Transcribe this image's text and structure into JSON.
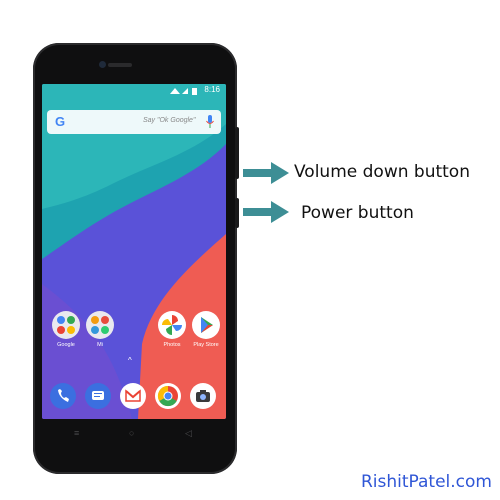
{
  "status_bar": {
    "time": "8:16"
  },
  "search": {
    "logo": "G",
    "placeholder": "Say \"Ok Google\""
  },
  "home_apps": [
    {
      "label": "Google",
      "icon": "google-folder-icon"
    },
    {
      "label": "Mi",
      "icon": "mi-folder-icon"
    },
    {
      "label": "Photos",
      "icon": "photos-icon"
    },
    {
      "label": "Play Store",
      "icon": "play-store-icon"
    }
  ],
  "dock": [
    {
      "icon": "phone-icon"
    },
    {
      "icon": "messages-icon"
    },
    {
      "icon": "gmail-icon"
    },
    {
      "icon": "chrome-icon"
    },
    {
      "icon": "camera-icon"
    }
  ],
  "nav": {
    "recents": "≡",
    "home": "○",
    "back": "◁"
  },
  "annotations": {
    "volume_down": "Volume down button",
    "power": "Power button"
  },
  "watermark": "RishitPatel.com",
  "colors": {
    "arrow": "#3d8e95",
    "watermark": "#2f56d6"
  }
}
